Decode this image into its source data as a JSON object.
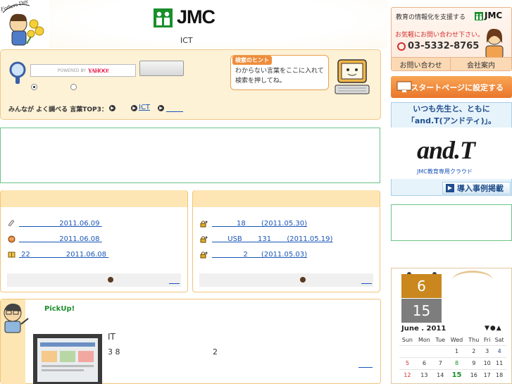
{
  "header": {
    "logo_text": "JMC",
    "ict_label": "ICT",
    "fathers_day_text": "Fathers Day"
  },
  "search": {
    "input_badge_prefix": "POWERED BY",
    "input_badge_brand": "YAHOO!",
    "button_label": "",
    "radio_selected": 0,
    "top3_label": "みんなが よく調べる 言葉TOP3：",
    "top3_items": [
      "ICT",
      ""
    ]
  },
  "hint": {
    "title": "検索のヒント",
    "text": "わからない言葉をここに入れて検索を押してね。"
  },
  "news_left": {
    "items": [
      {
        "icon": "paperclip-icon",
        "text": "                  2011.06.09 "
      },
      {
        "icon": "mascot-icon",
        "text": "                  2011.06.08 "
      },
      {
        "icon": "book-icon",
        "text": " 22                2011.06.08 "
      }
    ]
  },
  "news_right": {
    "items": [
      {
        "icon": "lock-person-icon",
        "text": "           18       (2011.05.30)"
      },
      {
        "icon": "lock-person-icon",
        "text": "       USB       131       (2011.05.19)"
      },
      {
        "icon": "lock-person-icon",
        "text": "              2      (2011.05.03)"
      }
    ]
  },
  "pickup": {
    "title": "PickUp!",
    "heading": "IT",
    "line1": "3 8",
    "line2": "2"
  },
  "contact": {
    "tagline": "教育の情報化を支援する",
    "logo_text": "JMC",
    "subtitle": "お気軽にお問い合わせ下さい。",
    "phone": "03-5332-8765",
    "inquiry_label": "お問い合わせ",
    "company_label": "会社案内"
  },
  "startpage": {
    "label": "スタートページに設定する"
  },
  "andt": {
    "line1": "いつも先生と、ともに",
    "line2": "「and.T(アンドティ)」。",
    "logo": "and.T",
    "cloud_text": "JMC教育専用クラウド",
    "case_label": "導入事例掲載"
  },
  "calendar": {
    "month_tile": "6",
    "day_tile": "15",
    "title": "June . 2011",
    "nav": "▼●▲",
    "weekdays": [
      "Sun",
      "Mon",
      "Tue",
      "Wed",
      "Thu",
      "Fri",
      "Sat"
    ],
    "weeks": [
      [
        "",
        "",
        "",
        "1",
        "2",
        "3",
        "4"
      ],
      [
        "5",
        "6",
        "7",
        "8",
        "9",
        "10",
        "11"
      ],
      [
        "12",
        "13",
        "14",
        "15",
        "16",
        "17",
        "18"
      ]
    ],
    "today": "15",
    "highlight_dates": [
      "8"
    ]
  },
  "colors": {
    "brand_green": "#1a8f2c",
    "accent_orange": "#ef8d3c",
    "panel_bg": "#fdf1d6",
    "link_blue": "#1a55b8"
  }
}
